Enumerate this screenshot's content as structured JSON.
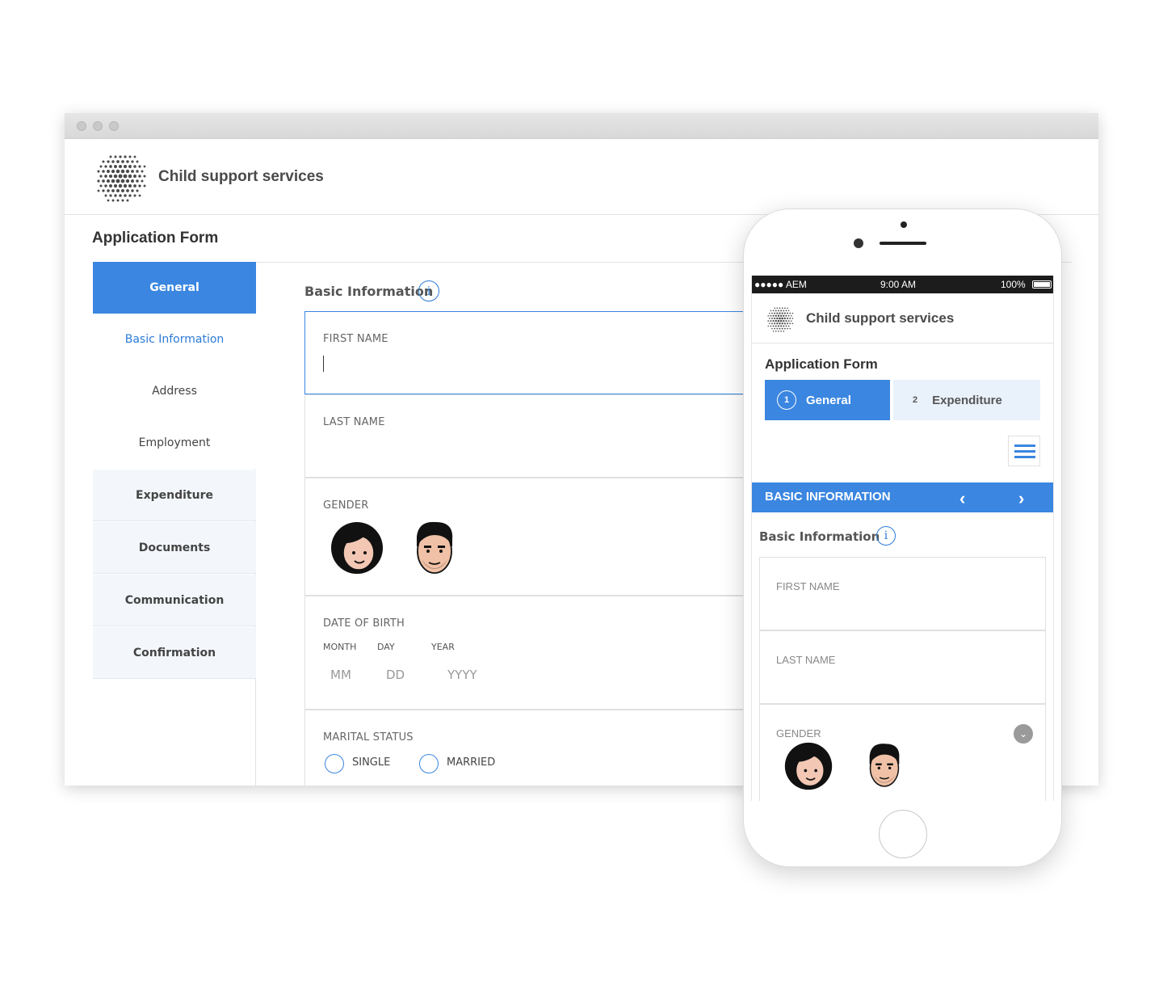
{
  "desktop": {
    "app_title": "Child support services",
    "form_title": "Application Form",
    "sidebar": {
      "active": "General",
      "subitems": [
        "Basic Information",
        "Address",
        "Employment"
      ],
      "sections": [
        "Expenditure",
        "Documents",
        "Communication",
        "Confirmation"
      ]
    },
    "section_heading": "Basic Information",
    "info_glyph": "i",
    "fields": {
      "first_name": "FIRST NAME",
      "last_name": "LAST NAME",
      "gender": "GENDER",
      "dob": "DATE OF BIRTH",
      "dob_month_label": "MONTH",
      "dob_day_label": "DAY",
      "dob_year_label": "YEAR",
      "dob_month_placeholder": "MM",
      "dob_day_placeholder": "DD",
      "dob_year_placeholder": "YYYY",
      "marital_status": "MARITAL STATUS",
      "single": "SINGLE",
      "married": "MARRIED"
    }
  },
  "mobile": {
    "status": {
      "carrier": "●●●●● AEM",
      "time": "9:00 AM",
      "battery": "100%"
    },
    "app_title": "Child support services",
    "form_title": "Application Form",
    "tabs": [
      {
        "step": "1",
        "label": "General"
      },
      {
        "step": "2",
        "label": "Expenditure"
      }
    ],
    "section_bar": "BASIC INFORMATION",
    "prev_glyph": "‹",
    "next_glyph": "›",
    "sub_heading": "Basic Information",
    "info_glyph": "i",
    "fields": {
      "first_name": "FIRST NAME",
      "last_name": "LAST NAME",
      "gender": "GENDER"
    },
    "dropdown_glyph": "⌄"
  },
  "colors": {
    "accent": "#3a86e0",
    "link": "#2c7bd6",
    "section_bg": "#f3f7fc"
  },
  "icons": [
    "logo-dots-icon",
    "info-icon",
    "female-avatar-icon",
    "male-avatar-icon",
    "menu-icon",
    "chevron-left-icon",
    "chevron-right-icon",
    "chevron-down-icon",
    "battery-icon"
  ]
}
